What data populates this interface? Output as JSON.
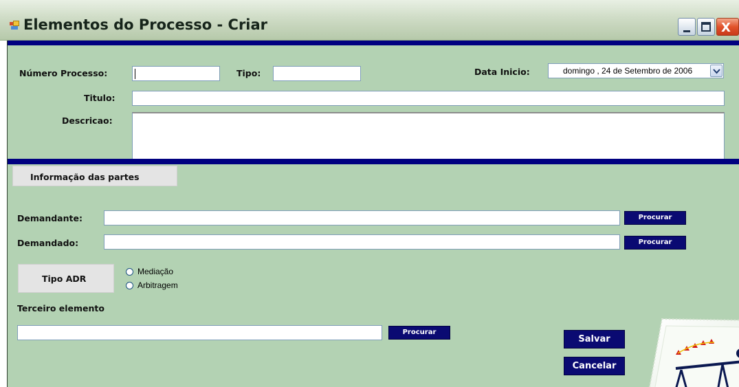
{
  "window": {
    "title": "Elementos do Processo - Criar",
    "controls": {
      "minimize": "_",
      "maximize": "□",
      "close": "X"
    }
  },
  "form": {
    "numero_processo": {
      "label": "Número Processo:",
      "value": ""
    },
    "tipo": {
      "label": "Tipo:",
      "value": ""
    },
    "data_inicio": {
      "label": "Data Inicio:",
      "value": "domingo    , 24 de Setembro de 2006"
    },
    "titulo": {
      "label": "Titulo:",
      "value": ""
    },
    "descricao": {
      "label": "Descricao:",
      "value": ""
    }
  },
  "partes": {
    "section_label": "Informação das partes",
    "demandante": {
      "label": "Demandante:",
      "value": "",
      "button": "Procurar"
    },
    "demandado": {
      "label": "Demandado:",
      "value": "",
      "button": "Procurar"
    }
  },
  "adr": {
    "label": "Tipo ADR",
    "options": [
      "Mediação",
      "Arbitragem"
    ],
    "selected": null
  },
  "terceiro": {
    "label": "Terceiro elemento",
    "value": "",
    "button": "Procurar"
  },
  "actions": {
    "save": "Salvar",
    "cancel": "Cancelar"
  },
  "colors": {
    "form_background": "#b3d2b3",
    "separator_bar": "#000080",
    "button_background": "#0a0a72",
    "title_bar": "#cfdcc6"
  }
}
